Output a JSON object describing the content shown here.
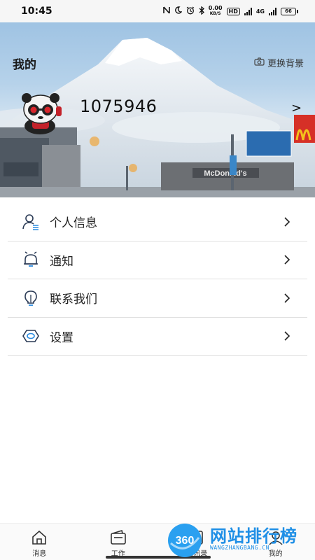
{
  "status_bar": {
    "time": "10:45",
    "net_speed_value": "0.00",
    "net_speed_unit": "KB/S",
    "hd_label": "HD",
    "network_label": "4G",
    "battery_level": "66"
  },
  "header": {
    "title": "我的",
    "change_background_label": "更换背景",
    "user_id": "1075946",
    "arrow": ">",
    "scene_sign_text": "McDonald's"
  },
  "menu": {
    "items": [
      {
        "label": "个人信息",
        "icon": "person-list-icon"
      },
      {
        "label": "通知",
        "icon": "bell-icon"
      },
      {
        "label": "联系我们",
        "icon": "lightbulb-icon"
      },
      {
        "label": "设置",
        "icon": "hexagon-eye-icon"
      }
    ]
  },
  "bottom_nav": {
    "items": [
      {
        "label": "消息",
        "icon": "home-icon"
      },
      {
        "label": "工作",
        "icon": "wallet-icon"
      },
      {
        "label": "通讯录",
        "icon": "contacts-icon"
      },
      {
        "label": "我的",
        "icon": "profile-icon"
      }
    ]
  },
  "watermark": {
    "logo_number": "360",
    "text": "网站排行榜",
    "sub": "WANGZHANGBANG.CN"
  },
  "colors": {
    "accent": "#1f8fe6",
    "icon_stroke": "#2a3a55",
    "divider": "#e1e1e1"
  }
}
